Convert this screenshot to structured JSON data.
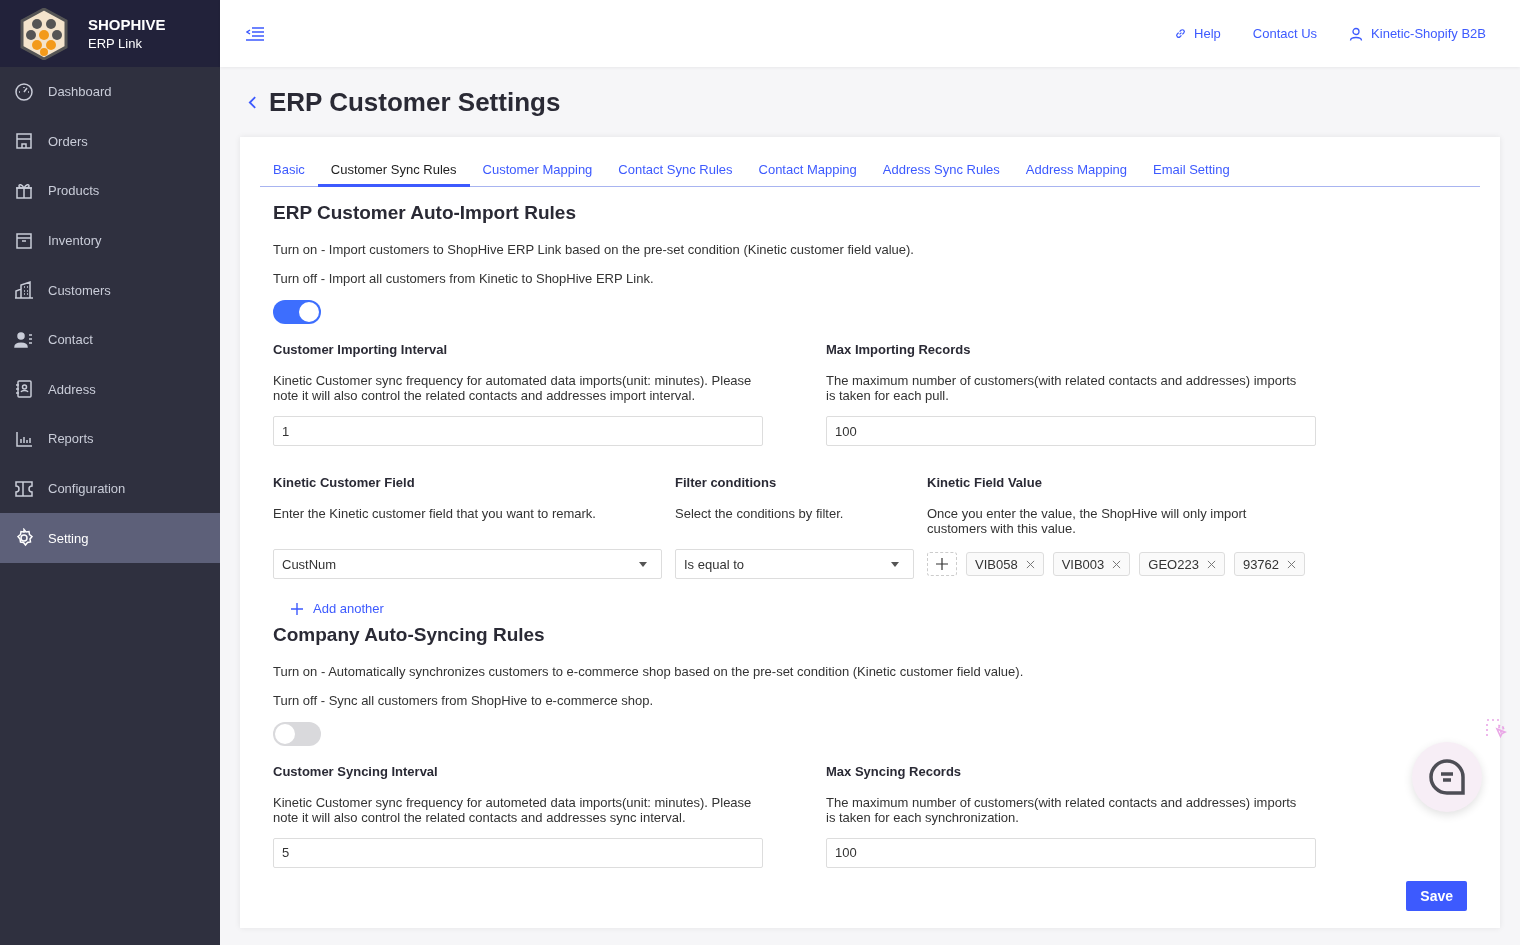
{
  "brand": {
    "name": "SHOPHIVE",
    "subtitle": "ERP Link"
  },
  "sidebar": {
    "items": [
      {
        "label": "Dashboard",
        "selected": false
      },
      {
        "label": "Orders",
        "selected": false
      },
      {
        "label": "Products",
        "selected": false
      },
      {
        "label": "Inventory",
        "selected": false
      },
      {
        "label": "Customers",
        "selected": false
      },
      {
        "label": "Contact",
        "selected": false
      },
      {
        "label": "Address",
        "selected": false
      },
      {
        "label": "Reports",
        "selected": false
      },
      {
        "label": "Configuration",
        "selected": false
      },
      {
        "label": "Setting",
        "selected": true
      }
    ]
  },
  "header": {
    "links": [
      {
        "label": "Help"
      },
      {
        "label": "Contact Us"
      },
      {
        "label": "Kinetic-Shopify B2B"
      }
    ]
  },
  "page": {
    "title": "ERP Customer Settings"
  },
  "tabs": [
    {
      "label": "Basic",
      "selected": false
    },
    {
      "label": "Customer Sync Rules",
      "selected": true
    },
    {
      "label": "Customer Mapping",
      "selected": false
    },
    {
      "label": "Contact Sync Rules",
      "selected": false
    },
    {
      "label": "Contact Mapping",
      "selected": false
    },
    {
      "label": "Address Sync Rules",
      "selected": false
    },
    {
      "label": "Address Mapping",
      "selected": false
    },
    {
      "label": "Email Setting",
      "selected": false
    }
  ],
  "sections": [
    {
      "title": "ERP Customer Auto-Import Rules",
      "descriptions": [
        "Turn on - Import customers to ShopHive ERP Link based on the pre-set condition (Kinetic customer field value).",
        "Turn off - Import all customers from Kinetic to ShopHive ERP Link."
      ],
      "toggle": {
        "on": true
      },
      "fields": [
        {
          "label": "Customer Importing Interval",
          "help": "Kinetic Customer sync frequency for automated data imports(unit: minutes). Please note it will also control the related contacts and addresses import interval.",
          "value": "1"
        },
        {
          "label": "Max Importing Records",
          "help": "The maximum number of customers(with related contacts and addresses) imports is taken for each pull.",
          "value": "100"
        }
      ],
      "filter": {
        "columns": [
          {
            "label": "Kinetic Customer Field",
            "help": "Enter the Kinetic customer field that you want to remark."
          },
          {
            "label": "Filter conditions",
            "help": "Select the conditions by filter."
          },
          {
            "label": "Kinetic Field Value",
            "help": "Once you enter the value, the ShopHive will only import customers with this value."
          }
        ],
        "field_select": "CustNum",
        "condition_select": "Is equal to",
        "tags": [
          "VIB058",
          "VIB003",
          "GEO223",
          "93762"
        ],
        "add_link": "Add another"
      }
    },
    {
      "title": "Company Auto-Syncing Rules",
      "descriptions": [
        "Turn on - Automatically synchronizes customers to e-commerce shop based on the pre-set condition (Kinetic customer field value).",
        "Turn off - Sync all customers from ShopHive to e-commerce shop."
      ],
      "toggle": {
        "on": false
      },
      "fields": [
        {
          "label": "Customer Syncing Interval",
          "help": "Kinetic Customer sync frequency for autometed data imports(unit: minutes). Please note it will also control the related contacts and addresses sync interval.",
          "value": "5"
        },
        {
          "label": "Max Syncing Records",
          "help": "The maximum number of customers(with related contacts and addresses) imports is taken for each synchronization.",
          "value": "100"
        }
      ]
    }
  ],
  "save_button": "Save"
}
